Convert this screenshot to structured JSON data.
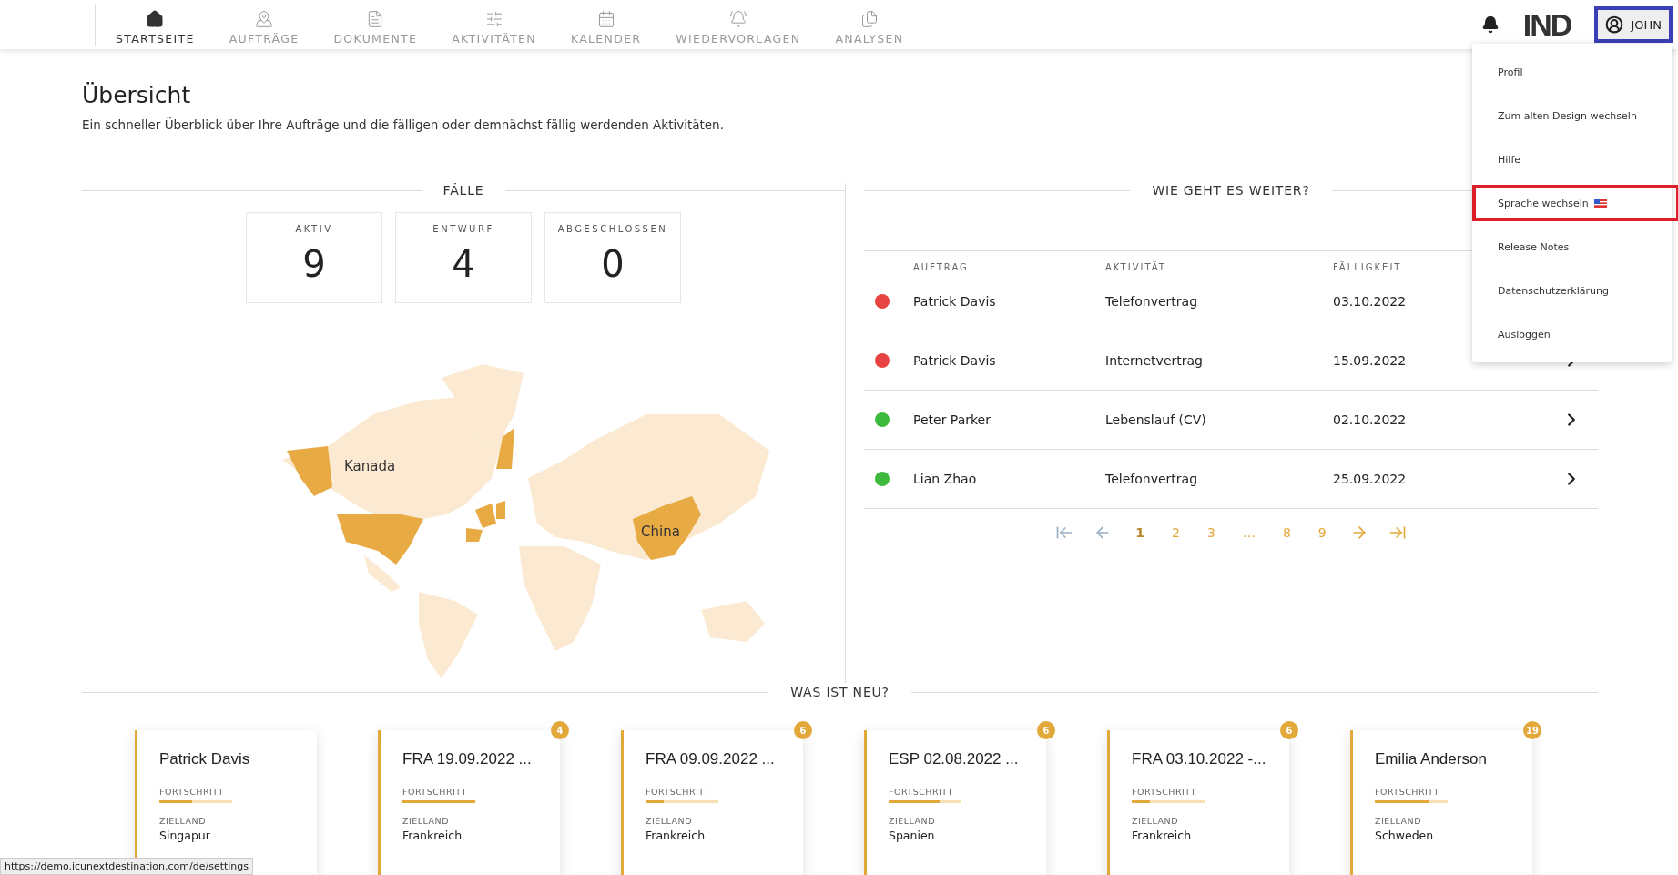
{
  "nav": {
    "items": [
      {
        "label": "STARTSEITE",
        "selected": true
      },
      {
        "label": "AUFTRÄGE",
        "selected": false
      },
      {
        "label": "DOKUMENTE",
        "selected": false
      },
      {
        "label": "AKTIVITÄTEN",
        "selected": false
      },
      {
        "label": "KALENDER",
        "selected": false
      },
      {
        "label": "WIEDERVORLAGEN",
        "selected": false
      },
      {
        "label": "ANALYSEN",
        "selected": false
      }
    ],
    "logo": "IND",
    "user": {
      "label": "JOHN",
      "highlighted": true
    }
  },
  "user_menu": {
    "items": [
      {
        "label": "Profil",
        "highlighted": false
      },
      {
        "label": "Zum alten Design wechseln",
        "highlighted": false
      },
      {
        "label": "Hilfe",
        "highlighted": false
      },
      {
        "label": "Sprache wechseln",
        "highlighted": true,
        "flag": true
      },
      {
        "label": "Release Notes",
        "highlighted": false
      },
      {
        "label": "Datenschutzerklärung",
        "highlighted": false
      },
      {
        "label": "Ausloggen",
        "highlighted": false
      }
    ]
  },
  "page": {
    "title": "Übersicht",
    "subtitle": "Ein schneller Überblick über Ihre Aufträge und die fälligen oder demnächst fällig werdenden Aktivitäten."
  },
  "cases": {
    "heading": "FÄLLE",
    "stats": [
      {
        "label": "AKTIV",
        "value": "9"
      },
      {
        "label": "ENTWURF",
        "value": "4"
      },
      {
        "label": "ABGESCHLOSSEN",
        "value": "0"
      }
    ],
    "map": {
      "labels": [
        "Kanada",
        "China"
      ]
    }
  },
  "next_steps": {
    "heading": "WIE GEHT ES WEITER?",
    "columns": [
      "AUFTRAG",
      "AKTIVITÄT",
      "FÄLLIGKEIT"
    ],
    "rows": [
      {
        "color": "#e84343",
        "order": "Patrick Davis",
        "activity": "Telefonvertrag",
        "due": "03.10.2022"
      },
      {
        "color": "#e84343",
        "order": "Patrick Davis",
        "activity": "Internetvertrag",
        "due": "15.09.2022"
      },
      {
        "color": "#3dba3d",
        "order": "Peter Parker",
        "activity": "Lebenslauf (CV)",
        "due": "02.10.2022"
      },
      {
        "color": "#3dba3d",
        "order": "Lian Zhao",
        "activity": "Telefonvertrag",
        "due": "25.09.2022"
      }
    ],
    "pagination": {
      "pages": [
        {
          "label": "1",
          "selected": true
        },
        {
          "label": "2",
          "selected": false
        },
        {
          "label": "3",
          "selected": false
        },
        {
          "label": "…",
          "selected": false
        },
        {
          "label": "8",
          "selected": false
        },
        {
          "label": "9",
          "selected": false
        }
      ]
    }
  },
  "news": {
    "heading": "WAS IST NEU?",
    "cards": [
      {
        "title": "Patrick Davis",
        "progress_label": "FORTSCHRITT",
        "level": 0.45,
        "country_label": "ZIELLAND",
        "country": "Singapur"
      },
      {
        "title": "FRA 19.09.2022 ...",
        "badge": "4",
        "progress_label": "FORTSCHRITT",
        "level": 1,
        "country_label": "ZIELLAND",
        "country": "Frankreich"
      },
      {
        "title": "FRA 09.09.2022 ...",
        "badge": "6",
        "progress_label": "FORTSCHRITT",
        "level": 0.25,
        "country_label": "ZIELLAND",
        "country": "Frankreich"
      },
      {
        "title": "ESP 02.08.2022 ...",
        "badge": "6",
        "progress_label": "FORTSCHRITT",
        "level": 0.7,
        "country_label": "ZIELLAND",
        "country": "Spanien"
      },
      {
        "title": "FRA 03.10.2022 -...",
        "badge": "6",
        "progress_label": "FORTSCHRITT",
        "level": 0.25,
        "country_label": "ZIELLAND",
        "country": "Frankreich"
      },
      {
        "title": "Emilia Anderson",
        "badge": "19",
        "progress_label": "FORTSCHRITT",
        "level": 0.75,
        "country_label": "ZIELLAND",
        "country": "Schweden"
      }
    ]
  },
  "status_bar": {
    "url": "https://demo.icunextdestination.com/de/settings"
  }
}
